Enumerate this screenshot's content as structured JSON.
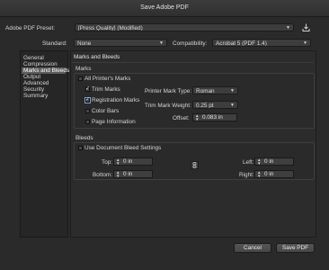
{
  "window": {
    "title": "Save Adobe PDF"
  },
  "preset": {
    "label": "Adobe PDF Preset:",
    "value": "[Press Quality] (Modified)"
  },
  "standard": {
    "label": "Standard:",
    "value": "None"
  },
  "compatibility": {
    "label": "Compatibility:",
    "value": "Acrobat 5 (PDF 1.4)"
  },
  "sidebar": {
    "items": [
      {
        "label": "General"
      },
      {
        "label": "Compression"
      },
      {
        "label": "Marks and Bleeds"
      },
      {
        "label": "Output"
      },
      {
        "label": "Advanced"
      },
      {
        "label": "Security"
      },
      {
        "label": "Summary"
      }
    ],
    "selected_index": 2
  },
  "panel": {
    "heading": "Marks and Bleeds"
  },
  "marks": {
    "heading": "Marks",
    "all_printers_marks": {
      "label": "All Printer's Marks",
      "checked": false
    },
    "trim_marks": {
      "label": "Trim Marks",
      "checked": true
    },
    "registration_marks": {
      "label": "Registration Marks",
      "checked": true
    },
    "color_bars": {
      "label": "Color Bars",
      "checked": false
    },
    "page_information": {
      "label": "Page Information",
      "checked": false
    },
    "printer_mark_type": {
      "label": "Printer Mark Type:",
      "value": "Roman"
    },
    "trim_mark_weight": {
      "label": "Trim Mark Weight:",
      "value": "0.25 pt"
    },
    "offset": {
      "label": "Offset:",
      "value": "0.083 in"
    }
  },
  "bleeds": {
    "heading": "Bleeds",
    "use_document": {
      "label": "Use Document Bleed Settings",
      "checked": false
    },
    "top": {
      "label": "Top:",
      "value": "0 in"
    },
    "bottom": {
      "label": "Bottom:",
      "value": "0 in"
    },
    "left": {
      "label": "Left:",
      "value": "0 in"
    },
    "right": {
      "label": "Right:",
      "value": "0 in"
    }
  },
  "buttons": {
    "cancel": "Cancel",
    "save": "Save PDF"
  }
}
